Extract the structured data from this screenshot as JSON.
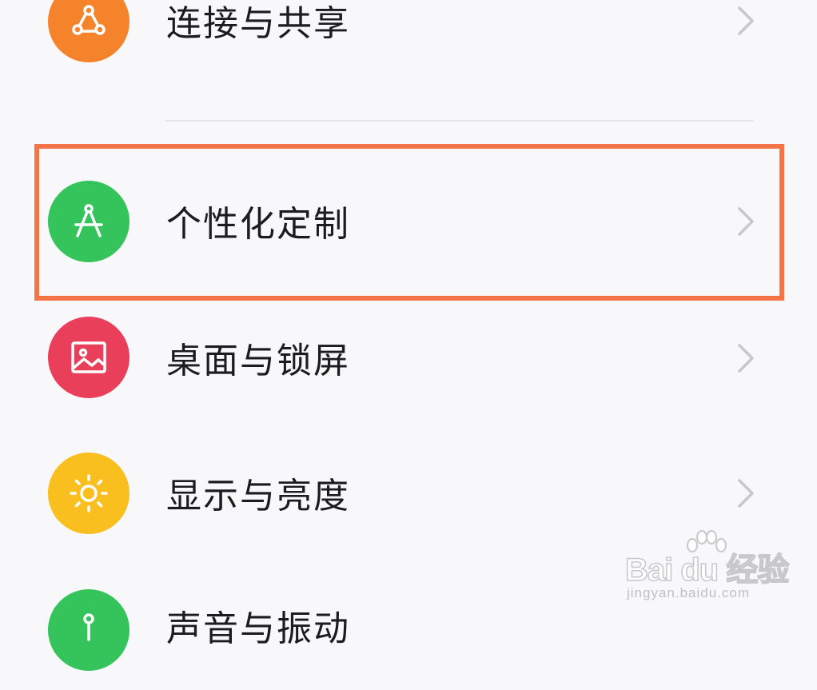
{
  "settings": {
    "items": [
      {
        "label": "连接与共享",
        "icon": "share-nodes-icon",
        "color": "#f5832b"
      },
      {
        "label": "个性化定制",
        "icon": "compass-icon",
        "color": "#34c45b",
        "highlighted": true
      },
      {
        "label": "桌面与锁屏",
        "icon": "image-icon",
        "color": "#ea3f5b"
      },
      {
        "label": "显示与亮度",
        "icon": "sun-icon",
        "color": "#f9bf1f"
      },
      {
        "label": "声音与振动",
        "icon": "sound-icon",
        "color": "#34c45b"
      }
    ]
  },
  "colors": {
    "highlight_border": "#f47448",
    "background": "#f8f8fa",
    "chevron": "#c7c7cc"
  },
  "watermark": {
    "logo": "Bai du 经验",
    "url": "jingyan.baidu.com"
  }
}
